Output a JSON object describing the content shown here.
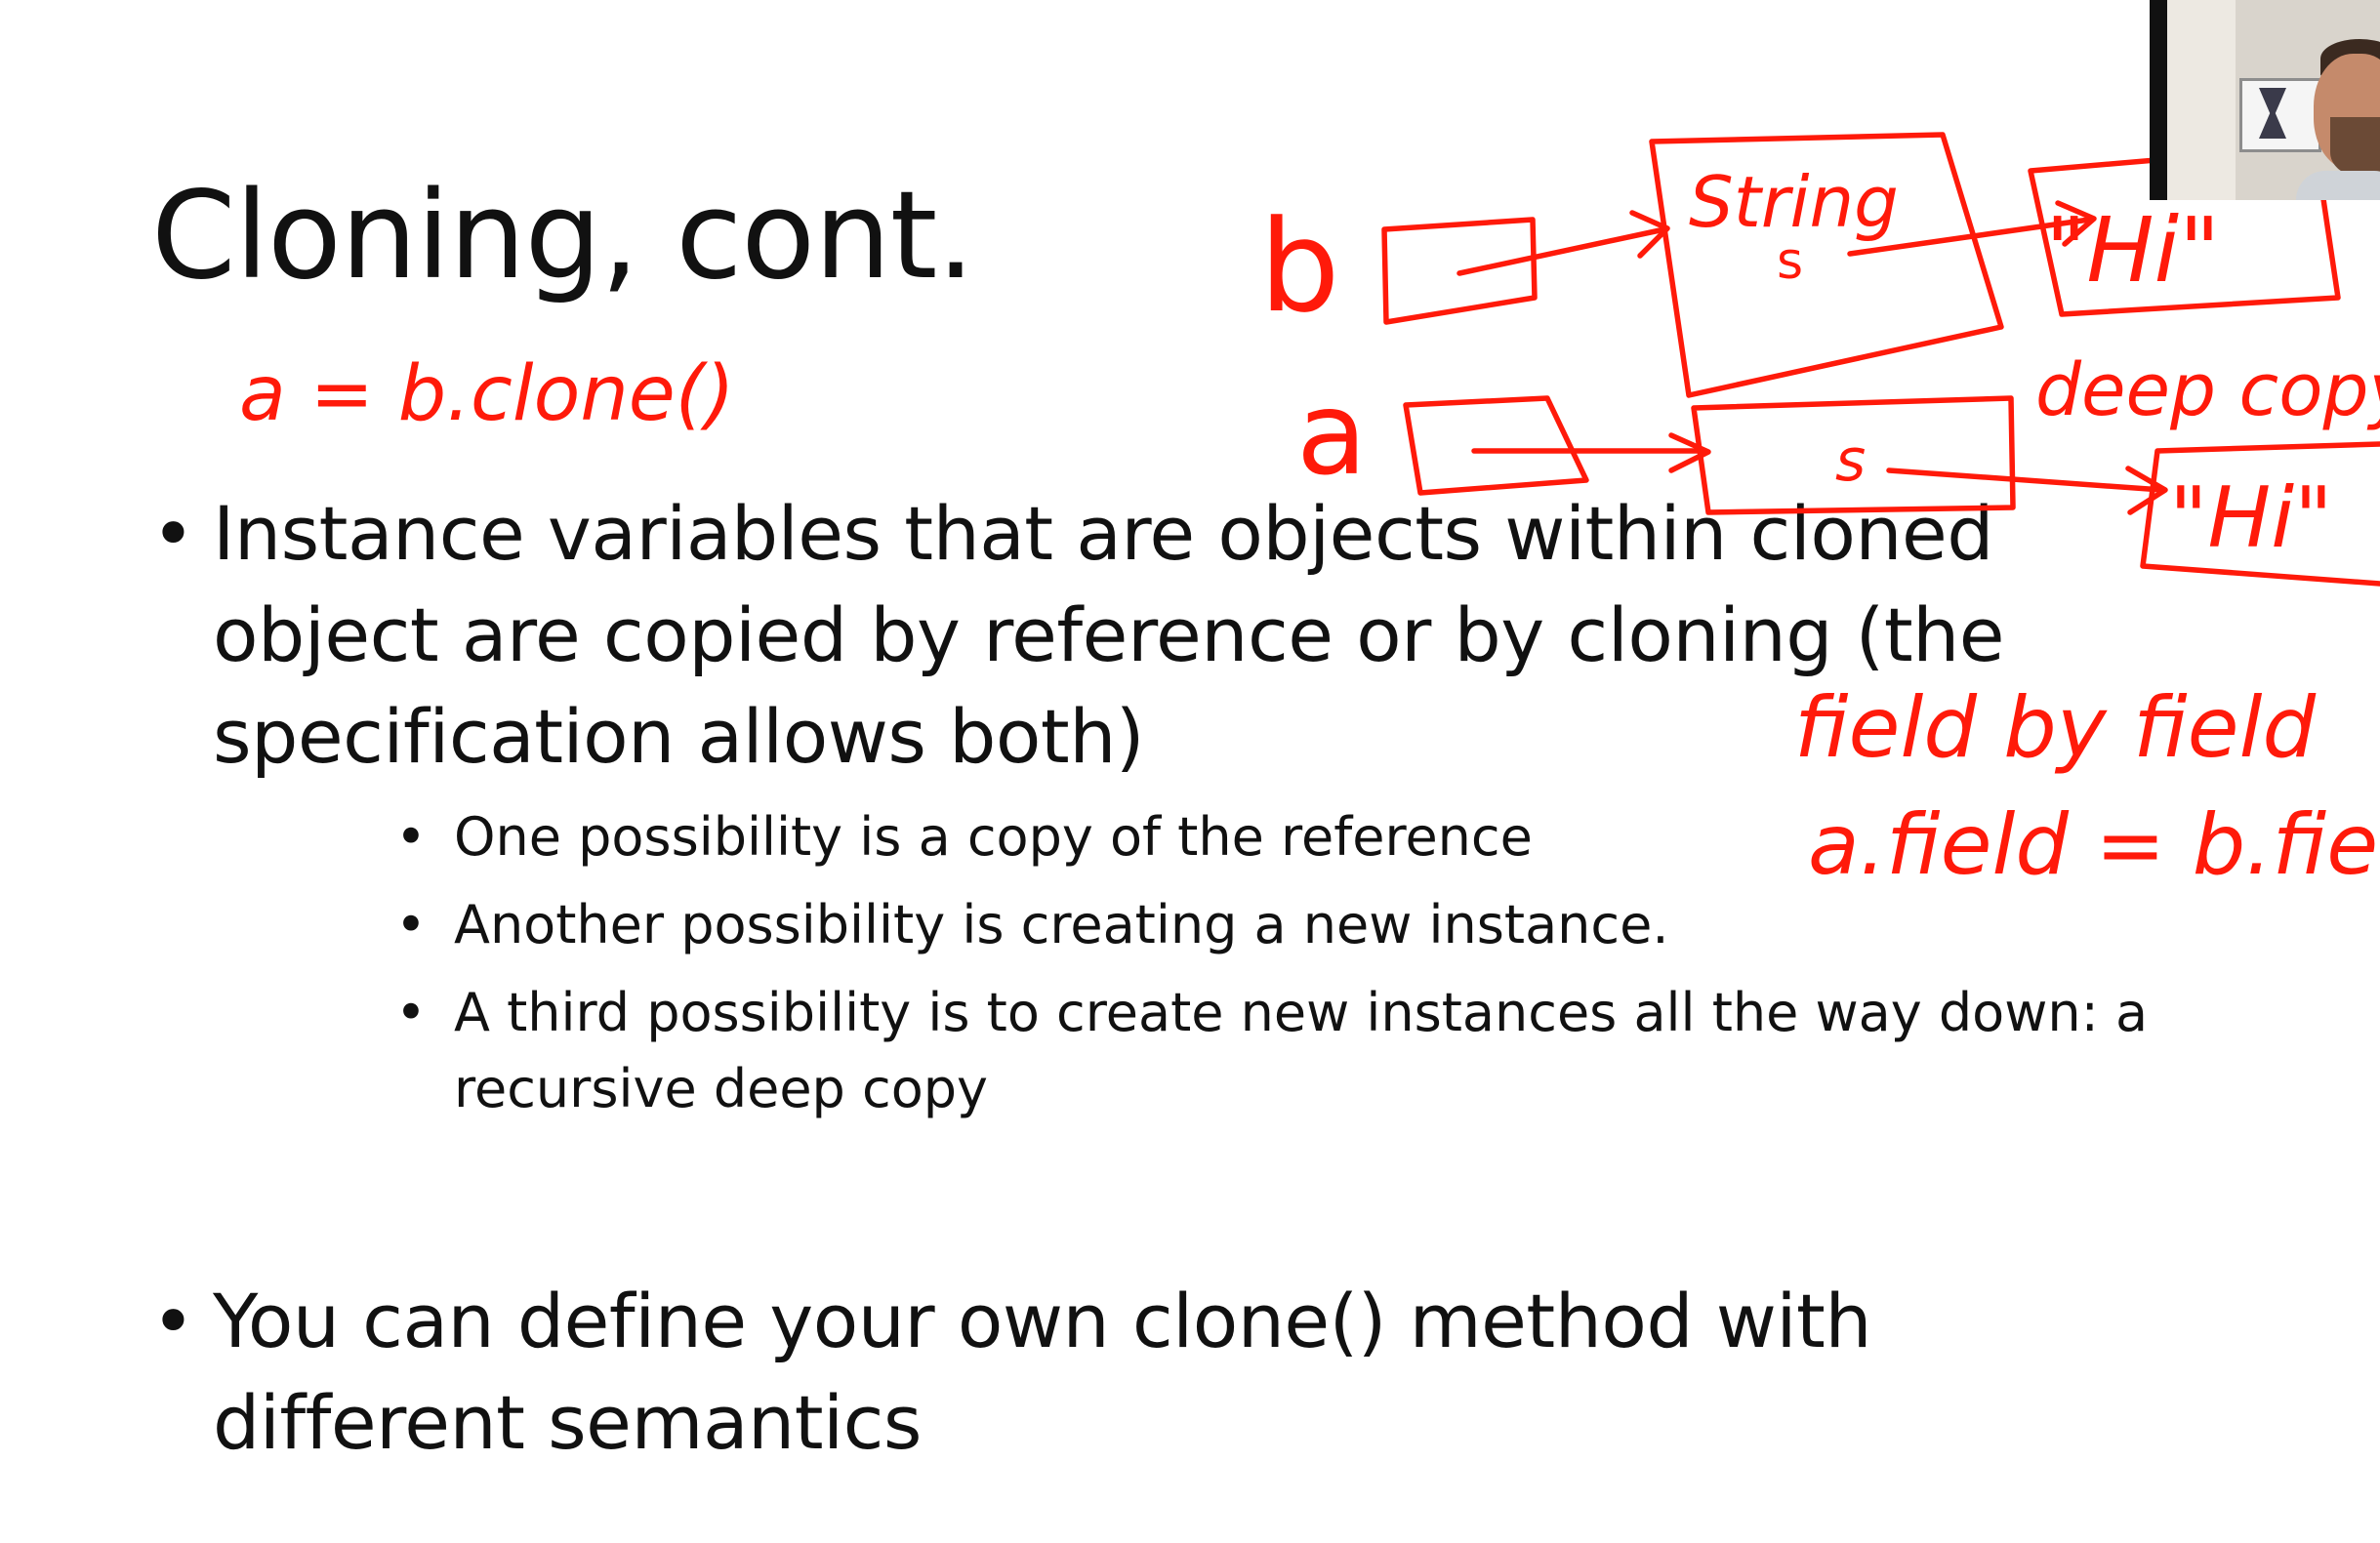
{
  "slide": {
    "title": "Cloning, cont.",
    "bullets": [
      {
        "text": "Instance variables that are objects within cloned object are copied by reference or by cloning (the specification allows both)",
        "sub": [
          "One possibility is a copy of the reference",
          "Another possibility is creating a new instance.",
          "A third possibility is to create new instances all the way down: a recursive deep copy"
        ]
      },
      {
        "text": "You can define your own clone() method with different semantics",
        "sub": []
      }
    ],
    "bullet_glyph": "•"
  },
  "annotations": {
    "ink_color": "#ff1a0a",
    "assignment": "a = b.clone()",
    "var_b": "b",
    "var_a": "a",
    "class_box_title": "String",
    "class_box_field": "s",
    "copy_box_field": "s",
    "string_value_top": "\"Hi\"",
    "string_value_bottom": "\"Hi\"",
    "deep_copy_note": "deep copy",
    "field_by_field_note": "field by field",
    "field_assignment": "a.field = b.field"
  },
  "webcam": {
    "icon": "presenter-webcam-icon"
  }
}
